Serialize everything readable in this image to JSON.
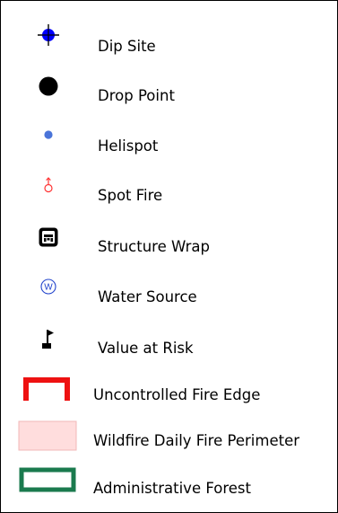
{
  "legend": {
    "items": [
      {
        "label": "Dip Site",
        "icon": "dip-site-icon",
        "color": "#0000ff"
      },
      {
        "label": "Drop Point",
        "icon": "drop-point-icon",
        "color": "#000000"
      },
      {
        "label": "Helispot",
        "icon": "helispot-icon",
        "color": "#4a74d9"
      },
      {
        "label": "Spot Fire",
        "icon": "spot-fire-icon",
        "color": "#ff3333"
      },
      {
        "label": "Structure Wrap",
        "icon": "structure-wrap-icon",
        "color": "#000000"
      },
      {
        "label": "Water Source",
        "icon": "water-source-icon",
        "color": "#2244cc"
      },
      {
        "label": "Value at Risk",
        "icon": "value-at-risk-icon",
        "color": "#000000"
      },
      {
        "label": "Uncontrolled Fire Edge",
        "icon": "uncontrolled-fire-edge-icon",
        "color": "#ee1111"
      },
      {
        "label": "Wildfire Daily Fire Perimeter",
        "icon": "wildfire-daily-fire-perimeter-icon",
        "color": "#ffdddd"
      },
      {
        "label": "Administrative Forest",
        "icon": "administrative-forest-icon",
        "color": "#1a7a4e"
      }
    ],
    "water_source_glyph": "W"
  }
}
